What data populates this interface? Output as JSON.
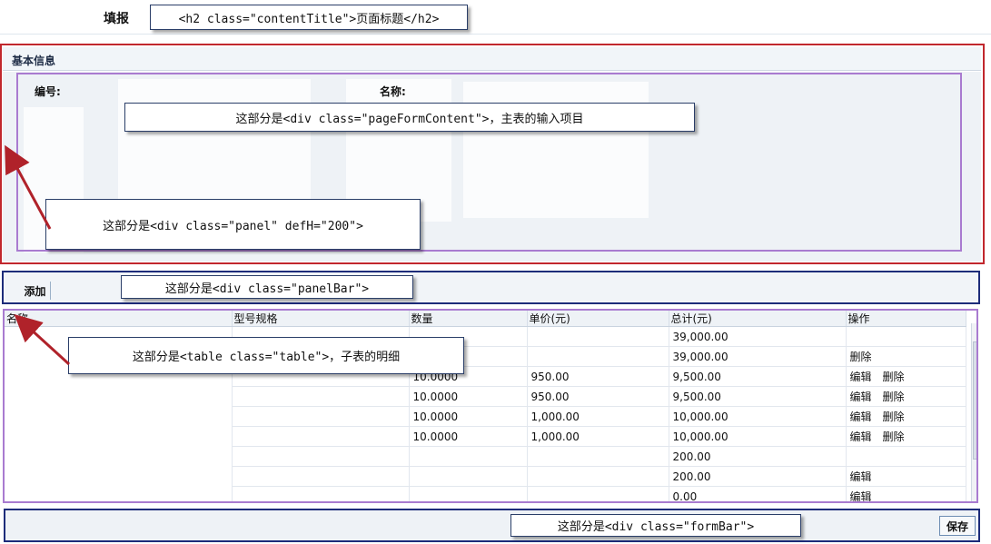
{
  "header": {
    "title": "填报",
    "callout": "<h2 class=\"contentTitle\">页面标题</h2>"
  },
  "panel": {
    "title": "基本信息",
    "fields": [
      {
        "label": "编号:"
      },
      {
        "label": "名称:"
      }
    ],
    "callout_form": "这部分是<div class=\"pageFormContent\">，主表的输入项目",
    "callout_panel": "这部分是<div class=\"panel\" defH=\"200\">"
  },
  "panelbar": {
    "add_label": "添加",
    "callout": "这部分是<div class=\"panelBar\">"
  },
  "table": {
    "callout": "这部分是<table class=\"table\">，子表的明细",
    "columns": [
      "名称",
      "型号规格",
      "数量",
      "单价(元)",
      "总计(元)",
      "操作"
    ],
    "rows": [
      {
        "name": "",
        "spec": "",
        "qty": "",
        "price": "",
        "total": "39,000.00",
        "actions": []
      },
      {
        "name": "",
        "spec": "",
        "qty": "",
        "price": "",
        "total": "39,000.00",
        "actions": [
          "删除"
        ]
      },
      {
        "name": "",
        "spec": "",
        "qty": "10.0000",
        "price": "950.00",
        "total": "9,500.00",
        "actions": [
          "编辑",
          "删除"
        ]
      },
      {
        "name": "",
        "spec": "",
        "qty": "10.0000",
        "price": "950.00",
        "total": "9,500.00",
        "actions": [
          "编辑",
          "删除"
        ]
      },
      {
        "name": "",
        "spec": "",
        "qty": "10.0000",
        "price": "1,000.00",
        "total": "10,000.00",
        "actions": [
          "编辑",
          "删除"
        ]
      },
      {
        "name": "",
        "spec": "",
        "qty": "10.0000",
        "price": "1,000.00",
        "total": "10,000.00",
        "actions": [
          "编辑",
          "删除"
        ]
      },
      {
        "name": "",
        "spec": "",
        "qty": "",
        "price": "",
        "total": "200.00",
        "actions": []
      },
      {
        "name": "",
        "spec": "",
        "qty": "",
        "price": "",
        "total": "200.00",
        "actions": [
          "编辑"
        ]
      },
      {
        "name": "",
        "spec": "",
        "qty": "",
        "price": "",
        "total": "0.00",
        "actions": [
          "编辑"
        ]
      }
    ]
  },
  "formbar": {
    "save_label": "保存",
    "callout": "这部分是<div class=\"formBar\">"
  },
  "colors": {
    "panel_outline": "#c1272d",
    "form_outline": "#a97bd0",
    "bar_outline": "#1d2c7a",
    "arrow": "#b0222a"
  }
}
